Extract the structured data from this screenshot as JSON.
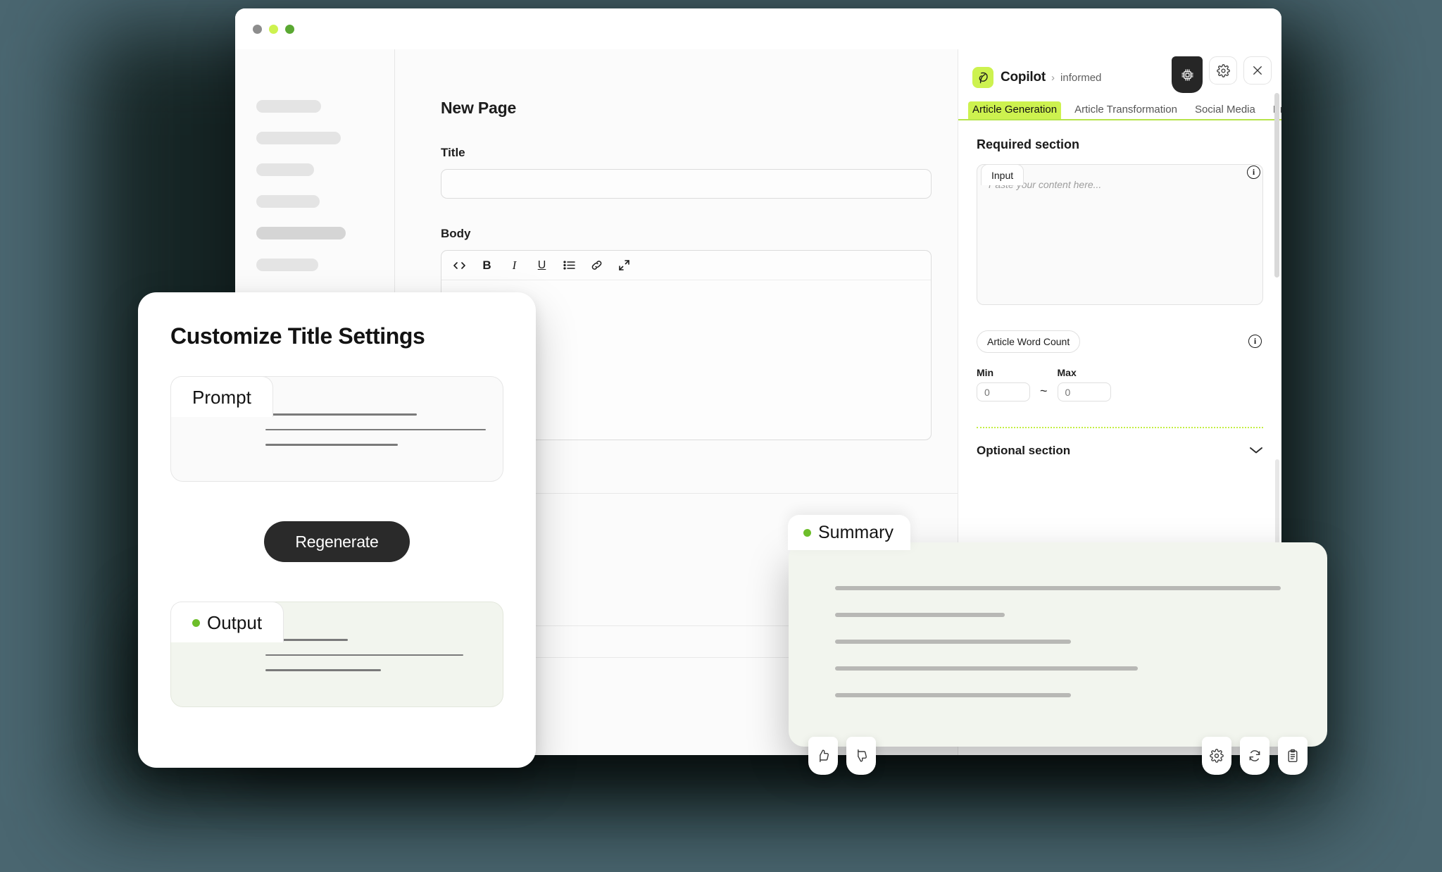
{
  "window": {
    "traffic_lights": [
      "close-gray",
      "minimize-lime",
      "maximize-green"
    ]
  },
  "sidebar": {
    "skeleton_widths": [
      92,
      120,
      82,
      90,
      127,
      88
    ]
  },
  "editor": {
    "page_title": "New Page",
    "title_field": {
      "label": "Title",
      "value": "",
      "placeholder": ""
    },
    "body_field": {
      "label": "Body"
    },
    "toolbar": [
      {
        "name": "code-icon",
        "label": "<>"
      },
      {
        "name": "bold-icon",
        "label": "B"
      },
      {
        "name": "italic-icon",
        "label": "I"
      },
      {
        "name": "underline-icon",
        "label": "U"
      },
      {
        "name": "bullet-list-icon",
        "label": "list"
      },
      {
        "name": "link-icon",
        "label": "link"
      },
      {
        "name": "fullscreen-icon",
        "label": "expand"
      }
    ]
  },
  "copilot": {
    "logo_color": "#cdf24f",
    "title": "Copilot",
    "separator": "›",
    "subtitle": "informed",
    "header_actions": [
      {
        "name": "chip-icon",
        "label": "AI Model"
      },
      {
        "name": "gear-icon",
        "label": "Settings"
      },
      {
        "name": "close-icon",
        "label": "Close"
      }
    ],
    "tabs": [
      {
        "label": "Article Generation",
        "active": true
      },
      {
        "label": "Article Transformation",
        "active": false
      },
      {
        "label": "Social Media",
        "active": false
      },
      {
        "label": "Press Rele",
        "active": false
      }
    ],
    "accent_color": "#cdf24f",
    "underline_color": "#b6e44a",
    "required_section": {
      "heading": "Required section",
      "input": {
        "tab_label": "Input",
        "placeholder": "Paste your content here...",
        "value": "",
        "info": "i"
      },
      "word_count": {
        "pill_label": "Article Word Count",
        "info": "i",
        "min_label": "Min",
        "min_value": "0",
        "max_label": "Max",
        "max_value": "0",
        "separator": "~"
      }
    },
    "optional_section": {
      "heading": "Optional section",
      "chevron": "chevron-down-icon"
    }
  },
  "settings_card": {
    "title": "Customize Title Settings",
    "prompt": {
      "tab_label": "Prompt",
      "line_widths": [
        55,
        80,
        48
      ]
    },
    "regenerate_label": "Regenerate",
    "output": {
      "tab_label": "Output",
      "dot_color": "#6dbe2a",
      "line_widths": [
        30,
        72,
        42
      ]
    }
  },
  "summary_card": {
    "tab_label": "Summary",
    "dot_color": "#6dbe2a",
    "line_widths": [
      100,
      38,
      53,
      68,
      53
    ],
    "actions_left": [
      {
        "name": "thumbs-up-icon",
        "label": "Like"
      },
      {
        "name": "thumbs-down-icon",
        "label": "Dislike"
      }
    ],
    "actions_right": [
      {
        "name": "gear-icon",
        "label": "Settings"
      },
      {
        "name": "refresh-icon",
        "label": "Regenerate"
      },
      {
        "name": "clipboard-icon",
        "label": "Copy"
      }
    ]
  }
}
